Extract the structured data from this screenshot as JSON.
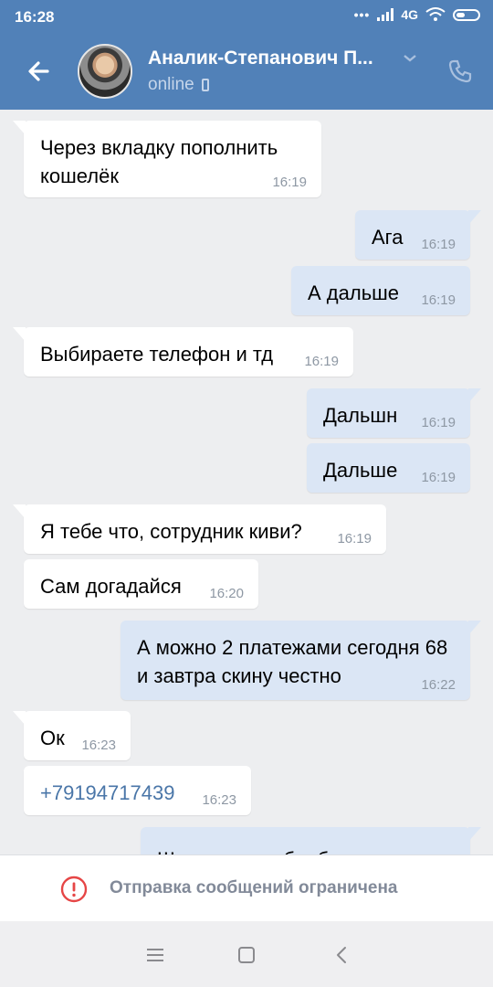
{
  "status_bar": {
    "time": "16:28",
    "dots": "•••",
    "network": "4G"
  },
  "header": {
    "contact_name": "Аналик-Степанович П...",
    "status": "online",
    "icons": {
      "back": "back-arrow-icon",
      "dropdown": "chevron-down-icon",
      "call": "phone-icon"
    }
  },
  "messages": [
    {
      "dir": "in",
      "text": "Через вкладку пополнить кошелёк",
      "time": "16:19"
    },
    {
      "dir": "out",
      "text": "Ага",
      "time": "16:19"
    },
    {
      "dir": "out",
      "text": "А дальше",
      "time": "16:19"
    },
    {
      "dir": "in",
      "text": "Выбираете телефон и тд",
      "time": "16:19"
    },
    {
      "dir": "out",
      "text": "Дальшн",
      "time": "16:19"
    },
    {
      "dir": "out",
      "text": "Дальше",
      "time": "16:19"
    },
    {
      "dir": "in",
      "text": "Я тебе что, сотрудник киви?",
      "time": "16:19"
    },
    {
      "dir": "in",
      "text": "Сам догадайся",
      "time": "16:20"
    },
    {
      "dir": "out",
      "text": "А можно 2 платежами сегодня 68 и завтра скину честно",
      "time": "16:22"
    },
    {
      "dir": "in",
      "text": "Ок",
      "time": "16:23"
    },
    {
      "dir": "in",
      "text": "+79194717439",
      "time": "16:23",
      "is_link": true
    },
    {
      "dir": "out",
      "text": "Щас запрос обрабатывается",
      "time": ""
    }
  ],
  "restricted_notice": {
    "text": "Отправка сообщений ограничена",
    "icon": "warning-icon",
    "color": "#e64646"
  },
  "nav": {
    "icons": [
      "menu-icon",
      "home-square-icon",
      "back-chevron-icon"
    ]
  },
  "colors": {
    "header": "#5181b8",
    "incoming": "#ffffff",
    "outgoing": "#dbe6f5",
    "background": "#edeef0",
    "link": "#4a76a8"
  }
}
